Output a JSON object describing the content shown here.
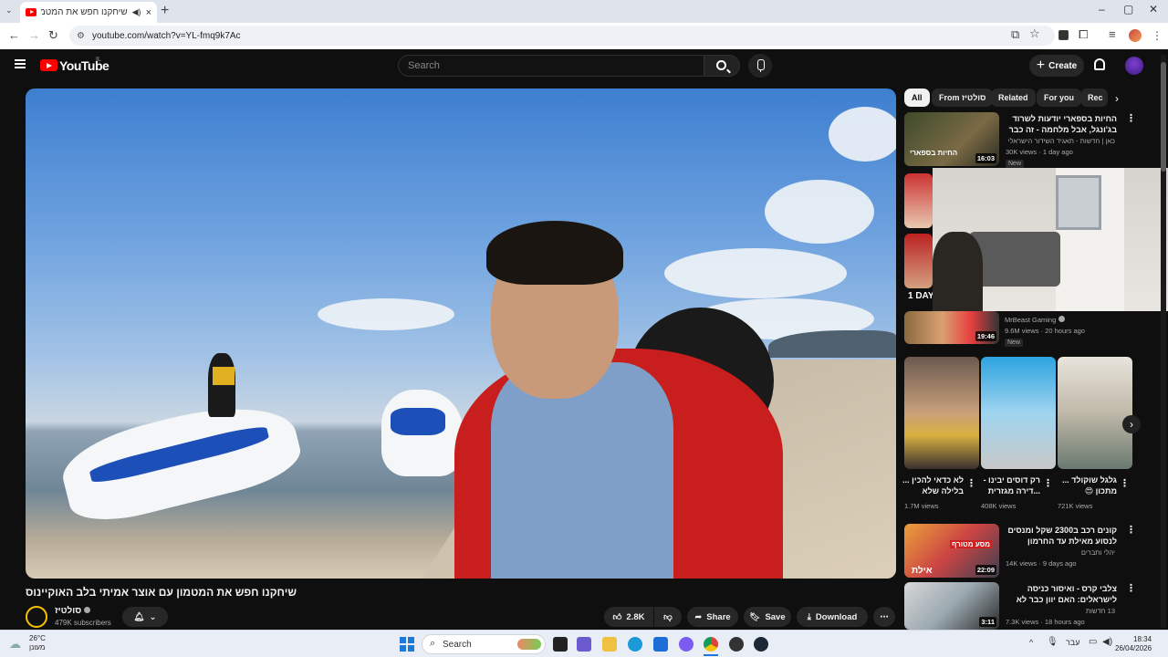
{
  "browser": {
    "tab_title": "שיחקנו חפש את המטמון עם...",
    "tab_close": "×",
    "tab_sound": "◀)",
    "new_tab": "+",
    "url": "youtube.com/watch?v=YL-fmq9k7Ac",
    "win_min": "–",
    "win_max": "▢",
    "win_close": "✕"
  },
  "yt": {
    "logo_text": "YouTube",
    "country": "IL",
    "search_placeholder": "Search",
    "create_label": "Create"
  },
  "video": {
    "title": "שיחקנו חפש את המטמון עם אוצר אמיתי בלב האוקיינוס",
    "channel": "סולטיז",
    "subscribers": "479K subscribers",
    "likes": "2.8K",
    "share": "Share",
    "save": "Save",
    "download": "Download"
  },
  "sidebar": {
    "chips": [
      "All",
      "From סולטיז",
      "Related",
      "For you",
      "Rec"
    ],
    "items": [
      {
        "title": "החיות בספארי יודעות לשרוד בג'ונגל, אבל מלחמה - זה כבר סיפור אחר",
        "channel": "כאן | חדשות - תאגיד השידור הישראלי",
        "meta": "30K views · 1 day ago",
        "badge": "New",
        "duration": "16:03"
      },
      {
        "title": "",
        "channel": "MrBeast Gaming",
        "meta": "9.6M views · 20 hours ago",
        "badge": "New",
        "duration": "19:46"
      },
      {
        "title": "קונים רכב ב2300 שקל ומנסים לנסוע מאילת עד החרמון",
        "channel": "יהלי ותברים",
        "meta": "14K views · 9 days ago",
        "duration": "22:09"
      },
      {
        "title": "צלבי קרס - ואיסור כניסה לישראלים: האם יוון כבר לא יעד בטוח?",
        "channel": "13 חדשות",
        "meta": "7.3K views · 18 hours ago",
        "duration": "3:11"
      }
    ],
    "shorts": [
      {
        "title": "לא כדאי להכין ... בלילה שלא",
        "views": "1.7M views"
      },
      {
        "title": "רק דוסים יבינו - ...דירה מגזרית",
        "views": "408K views"
      },
      {
        "title": "גלגל שוקולד ... מתכון 😍",
        "views": "721K views"
      }
    ],
    "thumb_texts": {
      "one_day": "1 DAY",
      "safari": "החיות בספארי",
      "eilat": "אילת",
      "car": "מסע מטורף"
    }
  },
  "taskbar": {
    "search": "Search",
    "temp": "26°C",
    "weather": "מעונן",
    "lang": "עבר",
    "time": "18:34",
    "date": "26/04/2026"
  },
  "colors": {
    "yt_red": "#ff0000",
    "bg": "#0f0f0f",
    "chip": "#272727"
  }
}
